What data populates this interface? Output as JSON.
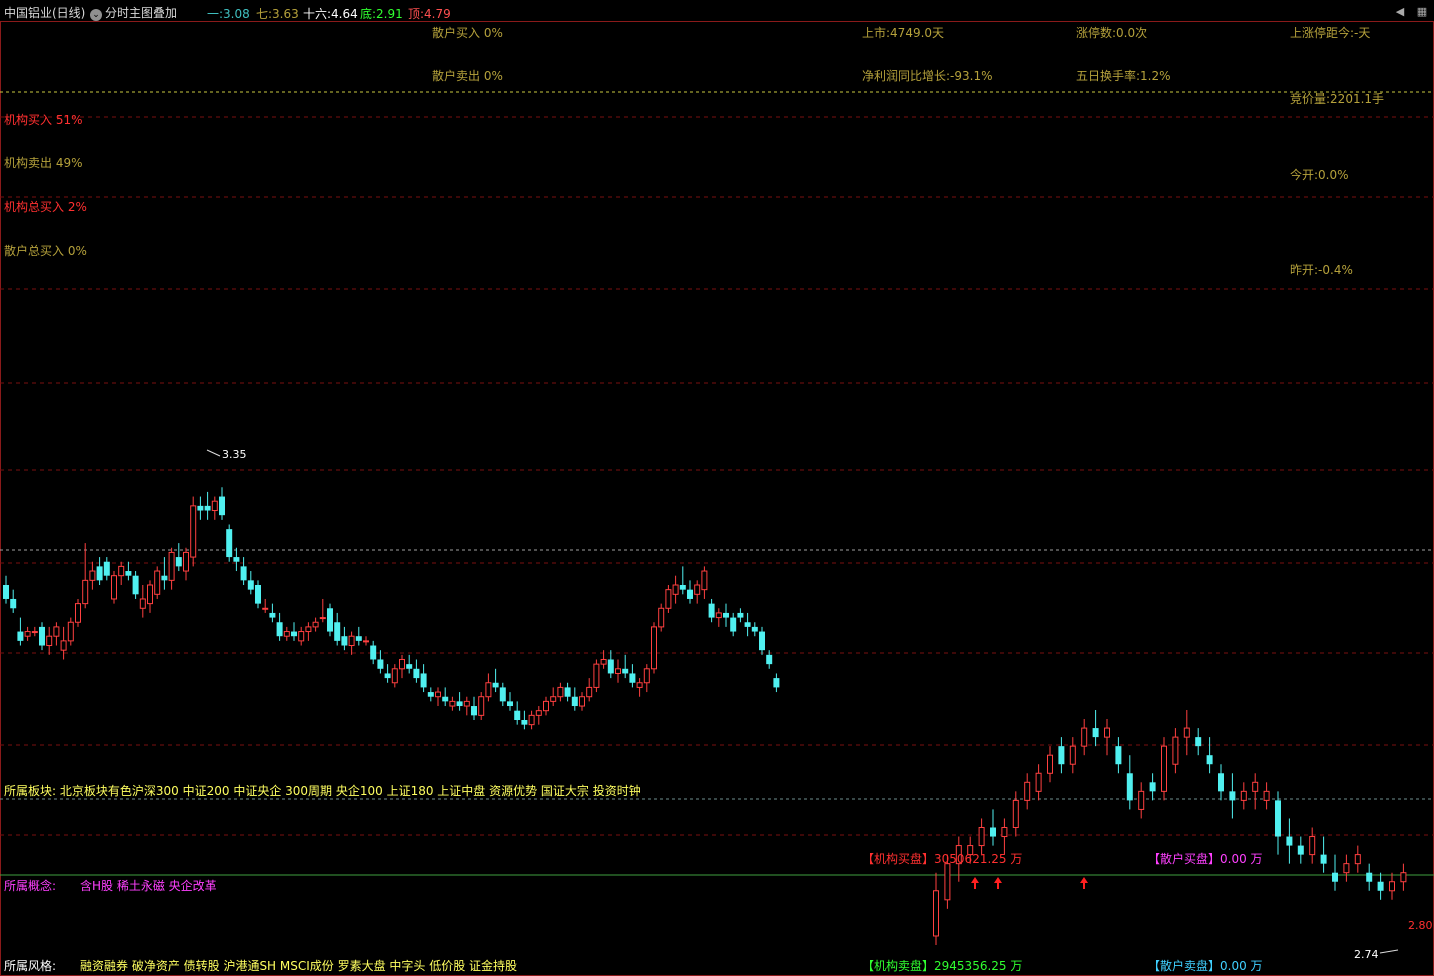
{
  "title": "中国铝业(日线)",
  "overlay_menu": "分时主图叠加",
  "ma": [
    {
      "label": "一:",
      "value": "3.08",
      "color": "#40c0c0"
    },
    {
      "label": "七:",
      "value": "3.63",
      "color": "#b5a13b"
    },
    {
      "label": "十六:",
      "value": "4.64",
      "color": "#ffffff"
    },
    {
      "label": "底:",
      "value": "2.91",
      "color": "#30ff30"
    },
    {
      "label": "顶:",
      "value": "4.79",
      "color": "#ff5050"
    }
  ],
  "stats": {
    "retail_buy": "散户买入 0%",
    "retail_sell": "散户卖出 0%",
    "listed": "上市:4749.0天",
    "profit_growth": "净利润同比增长:-93.1%",
    "limit_up_count": "涨停数:0.0次",
    "turnover_5d": "五日换手率:1.2%",
    "last_limit_up": "上涨停距今:-天",
    "auction_vol": "竞价量:2201.1手",
    "today_open": "今开:0.0%",
    "yesterday_open": "昨开:-0.4%",
    "inst_buy": "机构买入 51%",
    "inst_sell": "机构卖出 49%",
    "inst_total_buy": "机构总买入 2%",
    "retail_total_buy": "散户总买入 0%"
  },
  "sectors": {
    "label": "所属板块:",
    "value": "北京板块有色沪深300 中证200 中证央企 300周期 央企100 上证180 上证中盘 资源优势 国证大宗 投资时钟"
  },
  "concepts": {
    "label": "所属概念:",
    "value": "含H股 稀土永磁 央企改革"
  },
  "styles": {
    "label": "所属风格:",
    "value": "融资融券 破净资产 债转股 沪港通SH MSCI成份 罗素大盘 中字头 低价股 证金持股"
  },
  "orders": {
    "inst_buy_label": "【机构买盘】",
    "inst_buy_value": "3050621.25 万",
    "inst_sell_label": "【机构卖盘】",
    "inst_sell_value": "2945356.25 万",
    "retail_buy_label": "【散户买盘】",
    "retail_buy_value": "0.00 万",
    "retail_sell_label": "【散户卖盘】",
    "retail_sell_value": "0.00 万"
  },
  "price_labels": {
    "high": "3.35",
    "low": "2.74",
    "last": "2.80"
  },
  "chart_data": {
    "type": "candlestick",
    "ylim": [
      2.7,
      3.4
    ],
    "ohlc": [
      [
        3.06,
        3.08,
        3.02,
        3.03
      ],
      [
        3.03,
        3.05,
        3.0,
        3.01
      ],
      [
        2.96,
        2.99,
        2.93,
        2.94
      ],
      [
        2.95,
        2.97,
        2.94,
        2.96
      ],
      [
        2.96,
        2.97,
        2.95,
        2.96
      ],
      [
        2.97,
        2.98,
        2.92,
        2.93
      ],
      [
        2.93,
        2.97,
        2.91,
        2.95
      ],
      [
        2.95,
        2.98,
        2.93,
        2.97
      ],
      [
        2.92,
        2.97,
        2.9,
        2.94
      ],
      [
        2.94,
        2.99,
        2.93,
        2.98
      ],
      [
        2.98,
        3.03,
        2.97,
        3.02
      ],
      [
        3.02,
        3.15,
        3.01,
        3.07
      ],
      [
        3.07,
        3.11,
        3.05,
        3.09
      ],
      [
        3.1,
        3.12,
        3.06,
        3.07
      ],
      [
        3.11,
        3.12,
        3.07,
        3.08
      ],
      [
        3.03,
        3.09,
        3.02,
        3.08
      ],
      [
        3.08,
        3.11,
        3.06,
        3.1
      ],
      [
        3.09,
        3.11,
        3.07,
        3.08
      ],
      [
        3.08,
        3.09,
        3.03,
        3.04
      ],
      [
        3.01,
        3.06,
        2.99,
        3.03
      ],
      [
        3.02,
        3.07,
        3.0,
        3.06
      ],
      [
        3.04,
        3.1,
        3.03,
        3.09
      ],
      [
        3.08,
        3.12,
        3.05,
        3.07
      ],
      [
        3.07,
        3.14,
        3.05,
        3.13
      ],
      [
        3.12,
        3.15,
        3.09,
        3.1
      ],
      [
        3.09,
        3.14,
        3.07,
        3.13
      ],
      [
        3.12,
        3.25,
        3.1,
        3.23
      ],
      [
        3.23,
        3.25,
        3.2,
        3.22
      ],
      [
        3.23,
        3.26,
        3.2,
        3.22
      ],
      [
        3.22,
        3.25,
        3.2,
        3.24
      ],
      [
        3.25,
        3.27,
        3.2,
        3.21
      ],
      [
        3.18,
        3.19,
        3.11,
        3.12
      ],
      [
        3.12,
        3.14,
        3.09,
        3.11
      ],
      [
        3.1,
        3.12,
        3.06,
        3.07
      ],
      [
        3.07,
        3.09,
        3.04,
        3.05
      ],
      [
        3.06,
        3.07,
        3.01,
        3.02
      ],
      [
        3.01,
        3.03,
        3.0,
        3.01
      ],
      [
        3.0,
        3.02,
        2.98,
        2.99
      ],
      [
        2.98,
        3.0,
        2.94,
        2.95
      ],
      [
        2.95,
        2.97,
        2.94,
        2.96
      ],
      [
        2.96,
        2.98,
        2.94,
        2.95
      ],
      [
        2.94,
        2.97,
        2.93,
        2.96
      ],
      [
        2.96,
        2.98,
        2.94,
        2.97
      ],
      [
        2.97,
        2.99,
        2.96,
        2.98
      ],
      [
        2.99,
        3.03,
        2.98,
        2.99
      ],
      [
        3.01,
        3.02,
        2.95,
        2.96
      ],
      [
        2.98,
        3.0,
        2.93,
        2.94
      ],
      [
        2.95,
        2.97,
        2.92,
        2.93
      ],
      [
        2.93,
        2.96,
        2.91,
        2.95
      ],
      [
        2.95,
        2.97,
        2.93,
        2.94
      ],
      [
        2.94,
        2.95,
        2.93,
        2.94
      ],
      [
        2.93,
        2.94,
        2.89,
        2.9
      ],
      [
        2.9,
        2.92,
        2.87,
        2.88
      ],
      [
        2.87,
        2.89,
        2.85,
        2.86
      ],
      [
        2.85,
        2.89,
        2.84,
        2.88
      ],
      [
        2.88,
        2.91,
        2.86,
        2.9
      ],
      [
        2.89,
        2.91,
        2.87,
        2.88
      ],
      [
        2.88,
        2.9,
        2.85,
        2.86
      ],
      [
        2.87,
        2.89,
        2.83,
        2.84
      ],
      [
        2.83,
        2.84,
        2.81,
        2.82
      ],
      [
        2.82,
        2.84,
        2.8,
        2.83
      ],
      [
        2.82,
        2.84,
        2.8,
        2.81
      ],
      [
        2.8,
        2.82,
        2.79,
        2.81
      ],
      [
        2.81,
        2.83,
        2.79,
        2.8
      ],
      [
        2.8,
        2.82,
        2.78,
        2.81
      ],
      [
        2.8,
        2.82,
        2.77,
        2.78
      ],
      [
        2.78,
        2.83,
        2.77,
        2.82
      ],
      [
        2.82,
        2.87,
        2.81,
        2.85
      ],
      [
        2.85,
        2.88,
        2.83,
        2.84
      ],
      [
        2.84,
        2.85,
        2.8,
        2.81
      ],
      [
        2.81,
        2.83,
        2.79,
        2.8
      ],
      [
        2.79,
        2.81,
        2.76,
        2.77
      ],
      [
        2.77,
        2.79,
        2.75,
        2.76
      ],
      [
        2.76,
        2.79,
        2.75,
        2.78
      ],
      [
        2.78,
        2.8,
        2.76,
        2.79
      ],
      [
        2.79,
        2.82,
        2.78,
        2.81
      ],
      [
        2.81,
        2.84,
        2.8,
        2.82
      ],
      [
        2.82,
        2.85,
        2.81,
        2.84
      ],
      [
        2.84,
        2.85,
        2.81,
        2.82
      ],
      [
        2.82,
        2.84,
        2.79,
        2.8
      ],
      [
        2.8,
        2.83,
        2.79,
        2.82
      ],
      [
        2.82,
        2.86,
        2.81,
        2.84
      ],
      [
        2.84,
        2.9,
        2.83,
        2.89
      ],
      [
        2.89,
        2.92,
        2.88,
        2.9
      ],
      [
        2.9,
        2.92,
        2.86,
        2.87
      ],
      [
        2.87,
        2.9,
        2.85,
        2.88
      ],
      [
        2.88,
        2.91,
        2.86,
        2.87
      ],
      [
        2.87,
        2.89,
        2.84,
        2.85
      ],
      [
        2.84,
        2.86,
        2.82,
        2.85
      ],
      [
        2.85,
        2.89,
        2.83,
        2.88
      ],
      [
        2.88,
        2.98,
        2.87,
        2.97
      ],
      [
        2.97,
        3.02,
        2.96,
        3.01
      ],
      [
        3.01,
        3.06,
        3.0,
        3.05
      ],
      [
        3.04,
        3.08,
        3.02,
        3.06
      ],
      [
        3.06,
        3.1,
        3.04,
        3.05
      ],
      [
        3.05,
        3.07,
        3.02,
        3.03
      ],
      [
        3.04,
        3.07,
        3.02,
        3.06
      ],
      [
        3.05,
        3.1,
        3.03,
        3.09
      ],
      [
        3.02,
        3.03,
        2.98,
        2.99
      ],
      [
        2.99,
        3.01,
        2.97,
        3.0
      ],
      [
        3.0,
        3.02,
        2.97,
        2.99
      ],
      [
        2.99,
        3.0,
        2.95,
        2.96
      ],
      [
        3.0,
        3.01,
        2.98,
        2.99
      ],
      [
        2.98,
        3.0,
        2.95,
        2.97
      ],
      [
        2.97,
        2.98,
        2.95,
        2.96
      ],
      [
        2.96,
        2.97,
        2.91,
        2.92
      ],
      [
        2.91,
        2.92,
        2.88,
        2.89
      ],
      [
        2.86,
        2.87,
        2.83,
        2.84
      ]
    ]
  },
  "chart_data_2": {
    "type": "candlestick",
    "ohlc": [
      [
        2.75,
        2.82,
        2.74,
        2.8
      ],
      [
        2.79,
        2.84,
        2.78,
        2.83
      ],
      [
        2.83,
        2.86,
        2.81,
        2.85
      ],
      [
        2.84,
        2.86,
        2.83,
        2.85
      ],
      [
        2.85,
        2.88,
        2.84,
        2.87
      ],
      [
        2.87,
        2.89,
        2.85,
        2.86
      ],
      [
        2.86,
        2.88,
        2.84,
        2.87
      ],
      [
        2.87,
        2.91,
        2.86,
        2.9
      ],
      [
        2.9,
        2.93,
        2.89,
        2.92
      ],
      [
        2.91,
        2.94,
        2.9,
        2.93
      ],
      [
        2.93,
        2.96,
        2.92,
        2.95
      ],
      [
        2.96,
        2.97,
        2.93,
        2.94
      ],
      [
        2.94,
        2.97,
        2.93,
        2.96
      ],
      [
        2.96,
        2.99,
        2.95,
        2.98
      ],
      [
        2.98,
        3.0,
        2.96,
        2.97
      ],
      [
        2.97,
        2.99,
        2.95,
        2.98
      ],
      [
        2.96,
        2.97,
        2.93,
        2.94
      ],
      [
        2.93,
        2.95,
        2.89,
        2.9
      ],
      [
        2.89,
        2.92,
        2.88,
        2.91
      ],
      [
        2.92,
        2.93,
        2.9,
        2.91
      ],
      [
        2.91,
        2.97,
        2.9,
        2.96
      ],
      [
        2.94,
        2.98,
        2.93,
        2.97
      ],
      [
        2.97,
        3.0,
        2.95,
        2.98
      ],
      [
        2.97,
        2.98,
        2.95,
        2.96
      ],
      [
        2.95,
        2.97,
        2.93,
        2.94
      ],
      [
        2.93,
        2.94,
        2.9,
        2.91
      ],
      [
        2.91,
        2.93,
        2.88,
        2.9
      ],
      [
        2.9,
        2.92,
        2.89,
        2.91
      ],
      [
        2.91,
        2.93,
        2.89,
        2.92
      ],
      [
        2.9,
        2.92,
        2.89,
        2.91
      ],
      [
        2.9,
        2.91,
        2.84,
        2.86
      ],
      [
        2.86,
        2.88,
        2.83,
        2.85
      ],
      [
        2.85,
        2.86,
        2.83,
        2.84
      ],
      [
        2.84,
        2.87,
        2.83,
        2.86
      ],
      [
        2.84,
        2.86,
        2.82,
        2.83
      ],
      [
        2.82,
        2.84,
        2.8,
        2.81
      ],
      [
        2.82,
        2.84,
        2.81,
        2.83
      ],
      [
        2.83,
        2.85,
        2.82,
        2.84
      ],
      [
        2.82,
        2.83,
        2.8,
        2.81
      ],
      [
        2.81,
        2.82,
        2.79,
        2.8
      ],
      [
        2.8,
        2.82,
        2.79,
        2.81
      ],
      [
        2.81,
        2.83,
        2.8,
        2.82
      ]
    ]
  }
}
